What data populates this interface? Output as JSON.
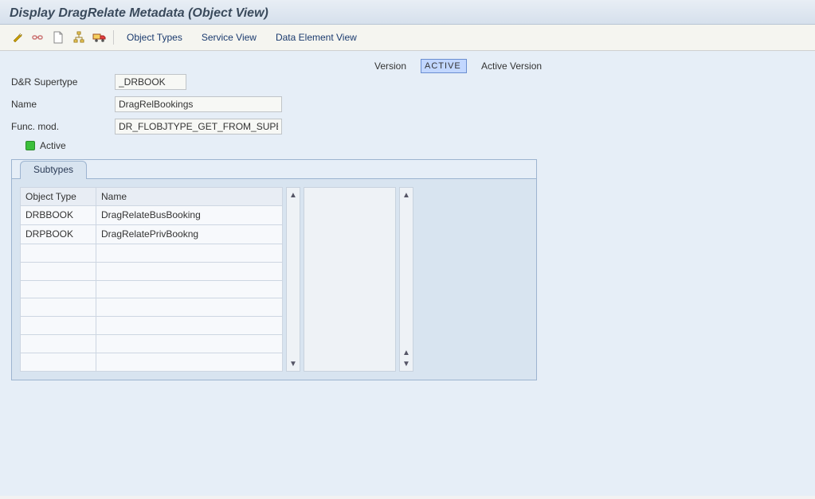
{
  "title": "Display DragRelate Metadata (Object View)",
  "toolbar": {
    "menu": {
      "object_types": "Object Types",
      "service_view": "Service View",
      "data_element_view": "Data Element View"
    }
  },
  "version": {
    "label": "Version",
    "value": "ACTIVE",
    "text": "Active Version"
  },
  "fields": {
    "supertype": {
      "label": "D&R Supertype",
      "value": "_DRBOOK"
    },
    "name": {
      "label": "Name",
      "value": "DragRelBookings"
    },
    "funcmod": {
      "label": "Func. mod.",
      "value": "DR_FLOBJTYPE_GET_FROM_SUPER"
    }
  },
  "status": {
    "text": "Active"
  },
  "tabs": {
    "subtypes": "Subtypes"
  },
  "grid": {
    "headers": {
      "objtype": "Object Type",
      "name": "Name"
    },
    "rows": [
      {
        "objtype": "DRBBOOK",
        "name": "DragRelateBusBooking"
      },
      {
        "objtype": "DRPBOOK",
        "name": "DragRelatePrivBookng"
      },
      {
        "objtype": "",
        "name": ""
      },
      {
        "objtype": "",
        "name": ""
      },
      {
        "objtype": "",
        "name": ""
      },
      {
        "objtype": "",
        "name": ""
      },
      {
        "objtype": "",
        "name": ""
      },
      {
        "objtype": "",
        "name": ""
      },
      {
        "objtype": "",
        "name": ""
      }
    ]
  }
}
